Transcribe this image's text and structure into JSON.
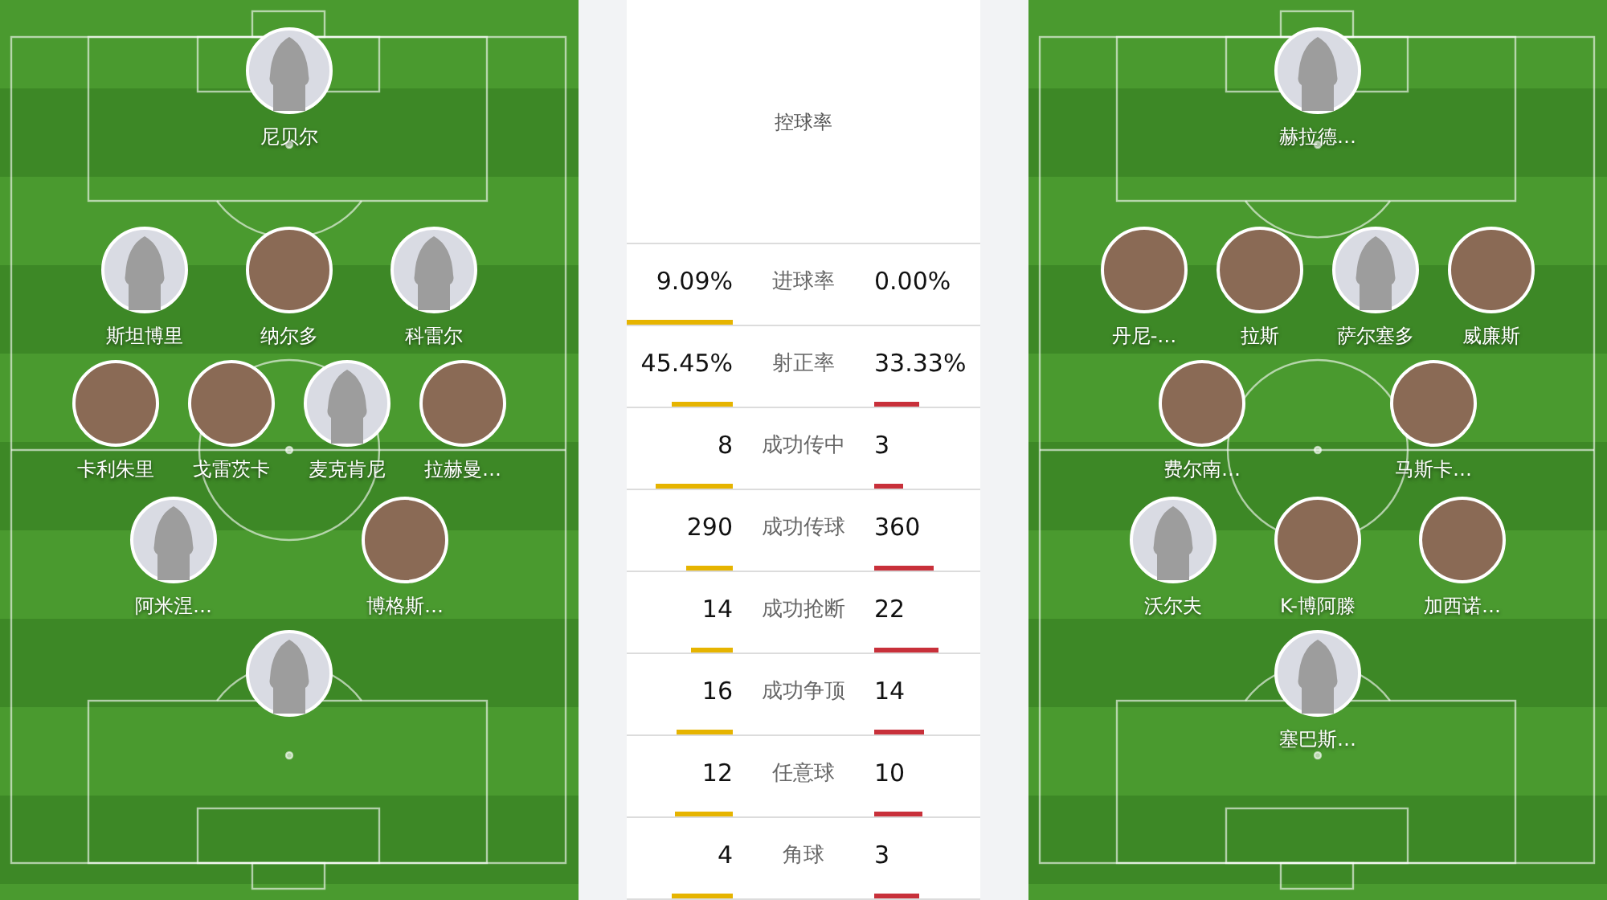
{
  "home_pitch": {
    "lines": [
      {
        "players": [
          {
            "name": "尼贝尔",
            "kind": "silhouette"
          }
        ]
      },
      {
        "players": [
          {
            "name": "斯坦博里",
            "kind": "silhouette"
          },
          {
            "name": "纳尔多",
            "kind": "photo"
          },
          {
            "name": "科雷尔",
            "kind": "silhouette"
          }
        ]
      },
      {
        "players": [
          {
            "name": "卡利朱里",
            "kind": "photo"
          },
          {
            "name": "戈雷茨卡",
            "kind": "photo"
          },
          {
            "name": "麦克肯尼",
            "kind": "silhouette"
          },
          {
            "name": "拉赫曼…",
            "kind": "photo"
          }
        ]
      },
      {
        "players": [
          {
            "name": "阿米涅…",
            "kind": "silhouette"
          },
          {
            "name": "博格斯…",
            "kind": "photo"
          }
        ]
      },
      {
        "players": [
          {
            "kind": "silhouette"
          }
        ]
      }
    ]
  },
  "stats": {
    "header": "控球率",
    "rows": [
      {
        "label": "进球率",
        "home": "9.09%",
        "away": "0.00%"
      },
      {
        "label": "射正率",
        "home": "45.45%",
        "away": "33.33%"
      },
      {
        "label": "成功传中",
        "home": "8",
        "away": "3"
      },
      {
        "label": "成功传球",
        "home": "290",
        "away": "360"
      },
      {
        "label": "成功抢断",
        "home": "14",
        "away": "22"
      },
      {
        "label": "成功争顶",
        "home": "16",
        "away": "14"
      },
      {
        "label": "任意球",
        "home": "12",
        "away": "10"
      },
      {
        "label": "角球",
        "home": "4",
        "away": "3"
      }
    ]
  },
  "away_pitch": {
    "lines": [
      {
        "players": [
          {
            "name": "赫拉德…",
            "kind": "silhouette"
          }
        ]
      },
      {
        "players": [
          {
            "name": "丹尼-…",
            "kind": "photo"
          },
          {
            "name": "拉斯",
            "kind": "photo"
          },
          {
            "name": "萨尔塞多",
            "kind": "silhouette"
          },
          {
            "name": "威廉斯",
            "kind": "photo"
          }
        ]
      },
      {
        "players": [
          {
            "name": "费尔南…",
            "kind": "photo"
          },
          {
            "name": "马斯卡…",
            "kind": "photo"
          }
        ]
      },
      {
        "players": [
          {
            "name": "沃尔夫",
            "kind": "silhouette"
          },
          {
            "name": "K-博阿滕",
            "kind": "photo"
          },
          {
            "name": "加西诺…",
            "kind": "photo"
          }
        ]
      },
      {
        "players": [
          {
            "name": "塞巴斯…",
            "kind": "silhouette"
          }
        ]
      }
    ]
  }
}
